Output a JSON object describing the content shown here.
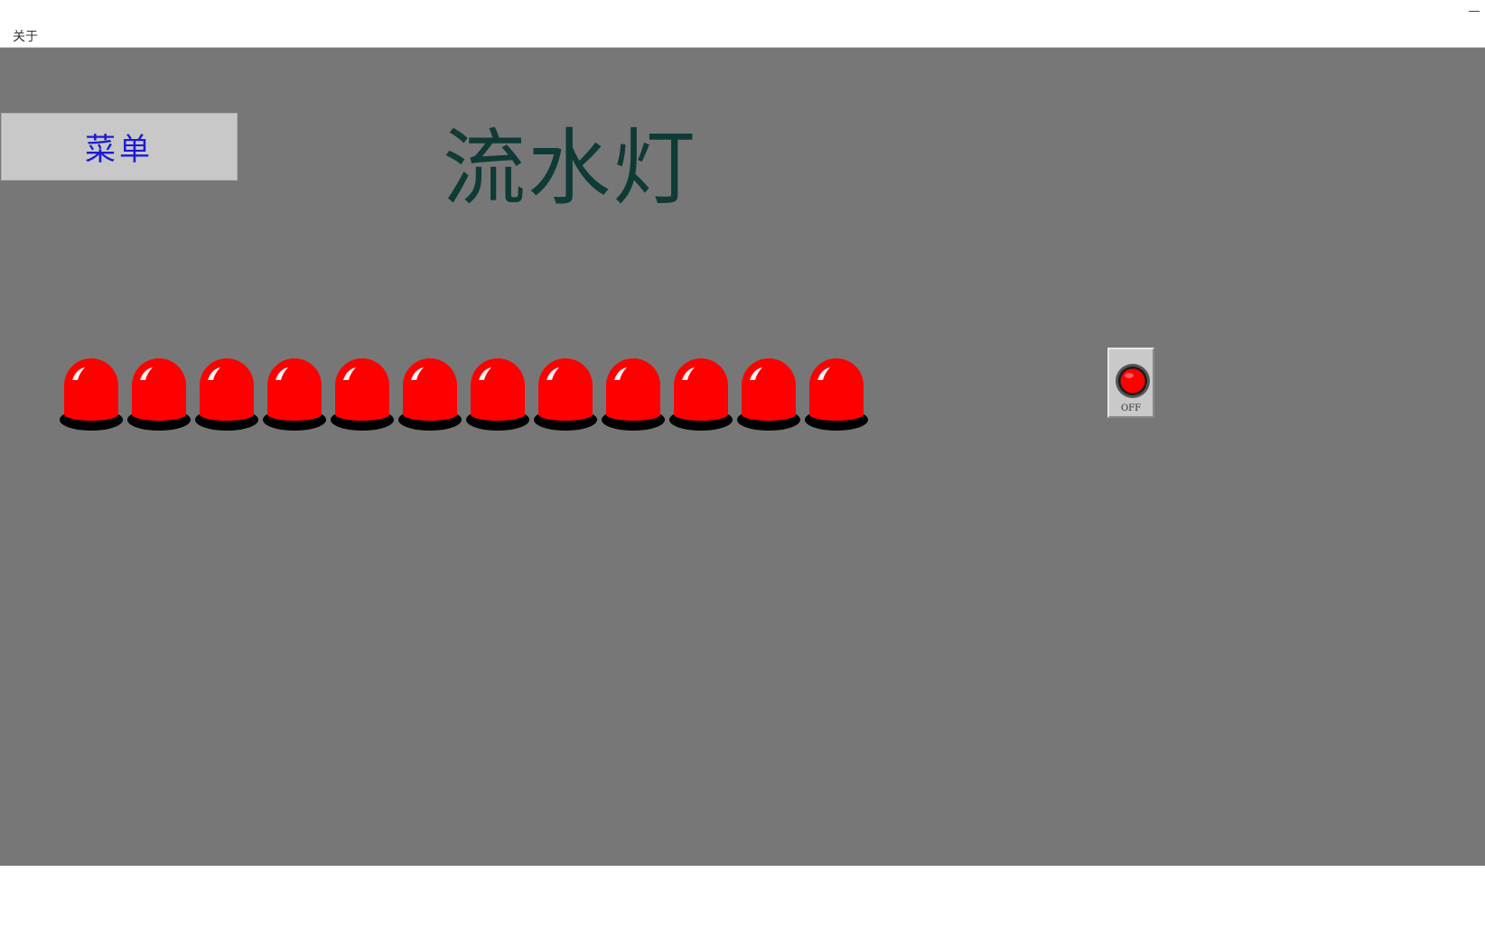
{
  "window": {
    "menu_about": "关于"
  },
  "colors": {
    "stage_bg": "#777777",
    "menu_text": "#1a1ad6",
    "title_text": "#0f3a35",
    "lamp_red": "#ff0000"
  },
  "menu_button": {
    "label": "菜单"
  },
  "title": "流水灯",
  "lamps": {
    "count": 12,
    "state": "on"
  },
  "switch": {
    "label": "OFF",
    "state": "off"
  }
}
